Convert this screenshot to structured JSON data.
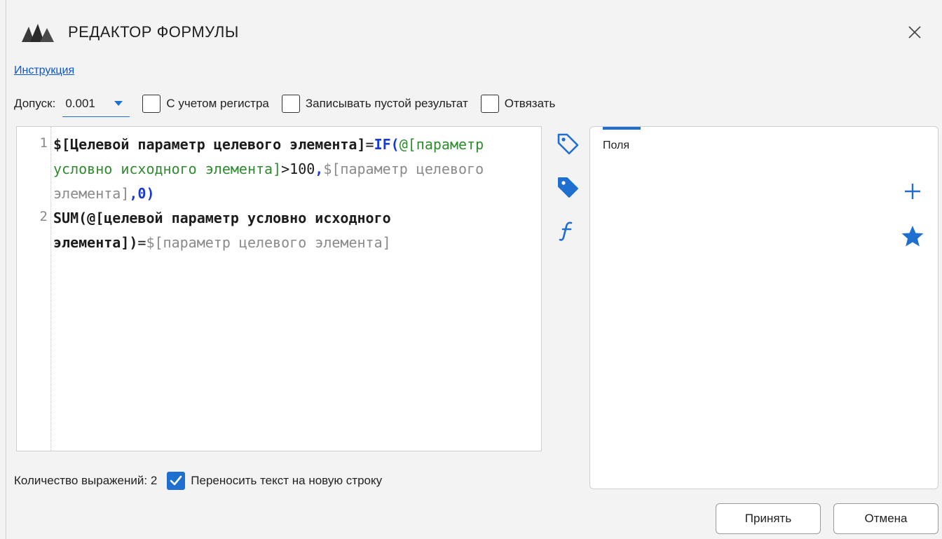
{
  "window": {
    "title": "РЕДАКТОР ФОРМУЛЫ",
    "close_icon": "close-icon"
  },
  "instruction_link": "Инструкция",
  "options": {
    "tolerance_label": "Допуск:",
    "tolerance_value": "0.001",
    "case_sensitive_label": "С учетом регистра",
    "case_sensitive_checked": false,
    "write_empty_label": "Записывать пустой результат",
    "write_empty_checked": false,
    "unbind_label": "Отвязать",
    "unbind_checked": false
  },
  "editor": {
    "line_numbers": [
      "1",
      "2"
    ],
    "line1": {
      "target": "$[Целевой параметр целевого элемента]",
      "eq": "=",
      "fn": "IF(",
      "source": "@[параметр условно исходного элемента]",
      "cmp": ">100",
      "comma1": ",",
      "ref": "$[параметр целевого элемента]",
      "tail": ",0)"
    },
    "line2": {
      "fn": "SUM(",
      "source": "@[целевой параметр условно исходного элемента]",
      "close": ")",
      "eq": "=",
      "ref": "$[параметр целевого элемента]"
    }
  },
  "side_icons": [
    "tag-outline-icon",
    "tag-filled-icon",
    "function-icon"
  ],
  "panel": {
    "tab_label": "Поля",
    "icons": [
      "plus-icon",
      "star-icon"
    ]
  },
  "status": {
    "count_text": "Количество выражений: 2",
    "wrap_label": "Переносить текст на новую строку",
    "wrap_checked": true
  },
  "buttons": {
    "accept": "Принять",
    "cancel": "Отмена"
  },
  "colors": {
    "accent": "#1f6fd0",
    "keyword": "#1a3ad6",
    "source_ref": "#2e8b2e",
    "target_ref": "#8a8a8a",
    "link": "#0a56d6"
  }
}
